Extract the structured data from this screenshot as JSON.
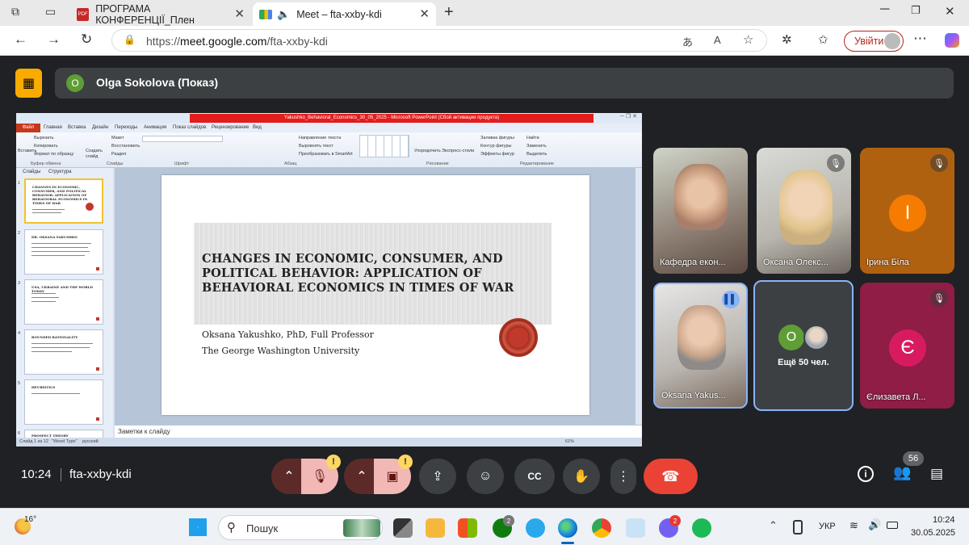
{
  "browser": {
    "tabs": [
      {
        "label": "ПРОГРАМА КОНФЕРЕНЦІЇ_Плен"
      },
      {
        "label": "Meet – fta-xxby-kdi"
      }
    ],
    "url_prefix": "https://",
    "url_host": "meet.google.com",
    "url_path": "/fta-xxby-kdi",
    "login_label": "Увійти"
  },
  "meet": {
    "presenter_initial": "O",
    "presenter_label": "Olga Sokolova (Показ)",
    "time": "10:24",
    "meeting_code": "fta-xxby-kdi",
    "people_count": "56",
    "participants": [
      {
        "name": "Кафедра екон..."
      },
      {
        "name": "Оксана Олекс..."
      },
      {
        "name": "Ірина Біла",
        "initial": "І"
      },
      {
        "name": "Oksana Yakus..."
      },
      {
        "name": "Ещё 50 чел.",
        "initial": "O"
      },
      {
        "name": "Єлизавета Л...",
        "initial": "Є"
      }
    ]
  },
  "ppt": {
    "title_bar": "Yakushko_Behavioral_Economics_30_05_2025 - Microsoft PowerPoint (Сбой активации продукта)",
    "menu": [
      "Файл",
      "Главная",
      "Вставка",
      "Дизайн",
      "Переходы",
      "Анимация",
      "Показ слайдов",
      "Рецензирование",
      "Вид"
    ],
    "ribbon_groups": [
      "Буфер обмена",
      "Слайды",
      "Шрифт",
      "Абзац",
      "Рисование",
      "Редактирование"
    ],
    "ribbon_items": [
      "Вырезать",
      "Копировать",
      "Формат по образцу",
      "Вставить",
      "Создать слайд",
      "Макет",
      "Восстановить",
      "Раздел",
      "Направление текста",
      "Выровнять текст",
      "Преобразовать в SmartArt",
      "Упорядочить",
      "Экспресс-стили",
      "Заливка фигуры",
      "Контур фигуры",
      "Эффекты фигур",
      "Найти",
      "Заменить",
      "Выделить"
    ],
    "panel_tabs": [
      "Слайды",
      "Структура"
    ],
    "thumbs": [
      {
        "num": "1",
        "title": "CHANGES IN ECONOMIC, CONSUMER, AND POLITICAL BEHAVIOR: APPLICATION OF BEHAVIORAL ECONOMICS IN TIMES OF WAR"
      },
      {
        "num": "2",
        "title": "DR. OKSANA YAKUSHKO"
      },
      {
        "num": "3",
        "title": "USA, UKRAINE AND THE WORLD TODAY"
      },
      {
        "num": "4",
        "title": "BOUNDED RATIONALITY"
      },
      {
        "num": "5",
        "title": "HEURISTICS"
      },
      {
        "num": "6",
        "title": "PROSPECT THEORY"
      }
    ],
    "slide": {
      "title": "CHANGES IN ECONOMIC, CONSUMER, AND POLITICAL BEHAVIOR: APPLICATION OF BEHAVIORAL ECONOMICS IN TIMES OF WAR",
      "author": "Oksana Yakushko, PhD, Full Professor",
      "university": "The George Washington University"
    },
    "notes_placeholder": "Заметки к слайду",
    "status_slide": "Слайд 1 из 12",
    "status_theme": "\"Wood Type\"",
    "status_lang": "русский",
    "zoom": "61%"
  },
  "taskbar": {
    "weather": "16°",
    "search_label": "Пошук",
    "lang": "УКР",
    "clock_time": "10:24",
    "clock_date": "30.05.2025",
    "badge_xbox": "2",
    "badge_viber": "2"
  }
}
